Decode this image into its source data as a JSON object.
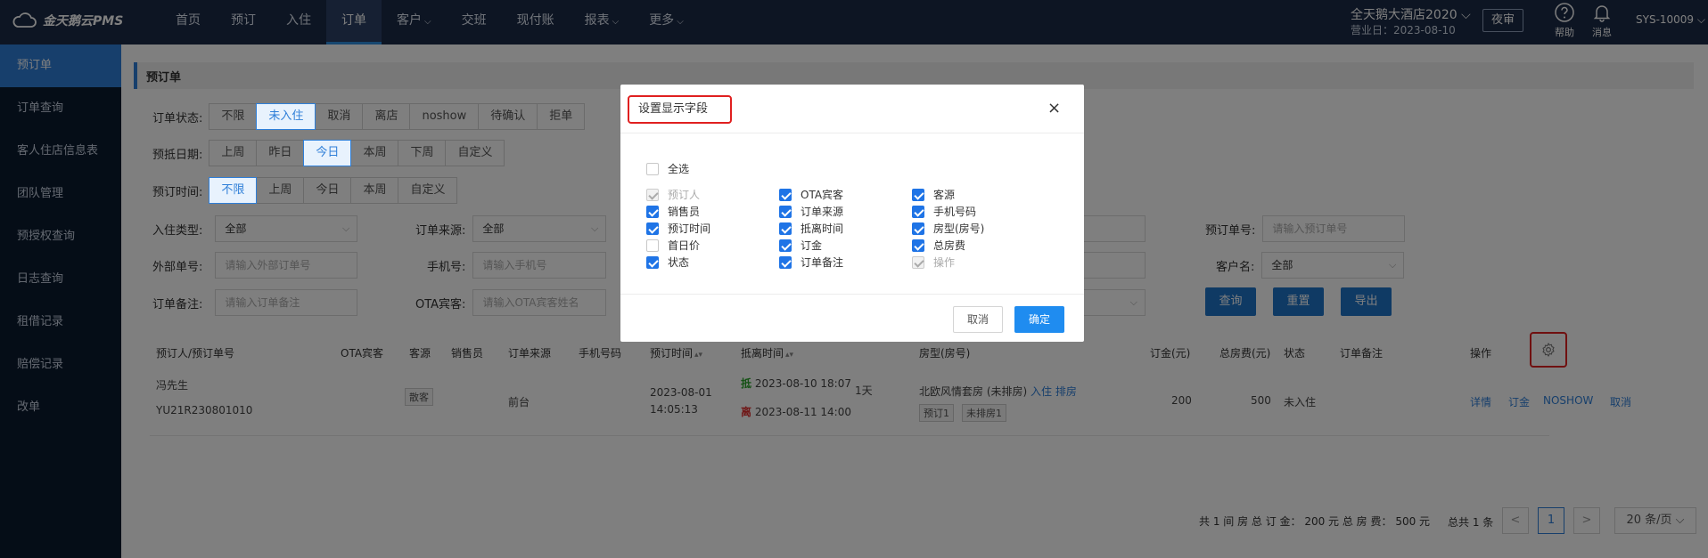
{
  "brand": {
    "name": "金天鹅云PMS"
  },
  "nav": {
    "items": [
      {
        "label": "首页",
        "caret": ""
      },
      {
        "label": "预订",
        "caret": ""
      },
      {
        "label": "入住",
        "caret": ""
      },
      {
        "label": "订单",
        "caret": ""
      },
      {
        "label": "客户",
        "caret": "⌵"
      },
      {
        "label": "交班",
        "caret": ""
      },
      {
        "label": "现付账",
        "caret": ""
      },
      {
        "label": "报表",
        "caret": "⌵"
      },
      {
        "label": "更多",
        "caret": "⌵"
      }
    ],
    "active_index": 3
  },
  "header": {
    "hotel": "全天鹅大酒店2020 ⌵",
    "biz_date": "营业日：2023-08-10",
    "night_audit": "夜审",
    "help": "帮助",
    "messages": "消息",
    "user": "SYS-10009 ⌵"
  },
  "sidebar": {
    "items": [
      "预订单",
      "订单查询",
      "客人住店信息表",
      "团队管理",
      "预授权查询",
      "日志查询",
      "租借记录",
      "赔偿记录",
      "改单"
    ],
    "active_index": 0
  },
  "page": {
    "title": "预订单"
  },
  "filters": {
    "status": {
      "label": "订单状态:",
      "options": [
        "不限",
        "未入住",
        "取消",
        "离店",
        "noshow",
        "待确认",
        "拒单"
      ]
    },
    "arrival": {
      "label": "预抵日期:",
      "options": [
        "上周",
        "昨日",
        "今日",
        "本周",
        "下周",
        "自定义"
      ]
    },
    "booking_time": {
      "label": "预订时间:",
      "options": [
        "不限",
        "上周",
        "今日",
        "本周",
        "自定义"
      ]
    },
    "checkin_type": {
      "label": "入住类型:",
      "value": "全部"
    },
    "order_source": {
      "label": "订单来源:",
      "value": "全部"
    },
    "booking_no": {
      "label": "预订单号:",
      "placeholder": "请输入预订单号"
    },
    "external_no": {
      "label": "外部单号:",
      "placeholder": "请输入外部订单号"
    },
    "phone": {
      "label": "手机号:",
      "placeholder": "请输入手机号"
    },
    "customer": {
      "label": "客户名:",
      "value": "全部"
    },
    "remark": {
      "label": "订单备注:",
      "placeholder": "请输入订单备注"
    },
    "ota_guest": {
      "label": "OTA宾客:",
      "placeholder": "请输入OTA宾客姓名"
    }
  },
  "actions": {
    "query": "查询",
    "reset": "重置",
    "export": "导出"
  },
  "table": {
    "headers": {
      "booker": "预订人/预订单号",
      "ota": "OTA宾客",
      "source": "客源",
      "sales": "销售员",
      "order_source": "订单来源",
      "phone": "手机号码",
      "booking_time": "预订时间",
      "arrive_leave": "抵离时间",
      "room": "房型(房号)",
      "deposit": "订金(元)",
      "total": "总房费(元)",
      "status": "状态",
      "remark": "订单备注",
      "op": "操作"
    },
    "row": {
      "booker": "冯先生",
      "order_no": "YU21R230801010",
      "source_tag": "散客",
      "order_source": "前台",
      "booking_date": "2023-08-01",
      "booking_clock": "14:05:13",
      "arrive_flag": "抵",
      "arrive": "2023-08-10 18:07",
      "nights": "1天",
      "leave_flag": "离",
      "leave": "2023-08-11 14:00",
      "room": "北欧风情套房 (未排房)",
      "room_checkin": "入住",
      "room_assign": "排房",
      "room_tag1": "预订1",
      "room_tag2": "未排房1",
      "deposit": "200",
      "total": "500",
      "status": "未入住",
      "ops": [
        "详情",
        "订金",
        "NOSHOW",
        "取消"
      ]
    }
  },
  "pager": {
    "summary": "共 1 间 房    总 订 金： 200 元    总 房 费： 500 元",
    "total": "总共 1 条",
    "prev": "<",
    "page": "1",
    "next": ">",
    "size": "20 条/页 ⌵"
  },
  "modal": {
    "title": "设置显示字段",
    "close": "×",
    "select_all": "全选",
    "fields": [
      {
        "label": "预订人",
        "state": "disabled"
      },
      {
        "label": "OTA宾客",
        "state": "on"
      },
      {
        "label": "客源",
        "state": "on"
      },
      {
        "label": "销售员",
        "state": "on"
      },
      {
        "label": "订单来源",
        "state": "on"
      },
      {
        "label": "手机号码",
        "state": "on"
      },
      {
        "label": "预订时间",
        "state": "on"
      },
      {
        "label": "抵离时间",
        "state": "on"
      },
      {
        "label": "房型(房号)",
        "state": "on"
      },
      {
        "label": "首日价",
        "state": "off"
      },
      {
        "label": "订金",
        "state": "on"
      },
      {
        "label": "总房费",
        "state": "on"
      },
      {
        "label": "状态",
        "state": "on"
      },
      {
        "label": "订单备注",
        "state": "on"
      },
      {
        "label": "操作",
        "state": "disabled"
      }
    ],
    "cancel": "取消",
    "confirm": "确定"
  },
  "colors": {
    "nav_bg": "#1b2a46",
    "sidebar_bg": "#0b1a2e",
    "accent": "#2f7fd8",
    "highlight_border": "#e02020"
  }
}
